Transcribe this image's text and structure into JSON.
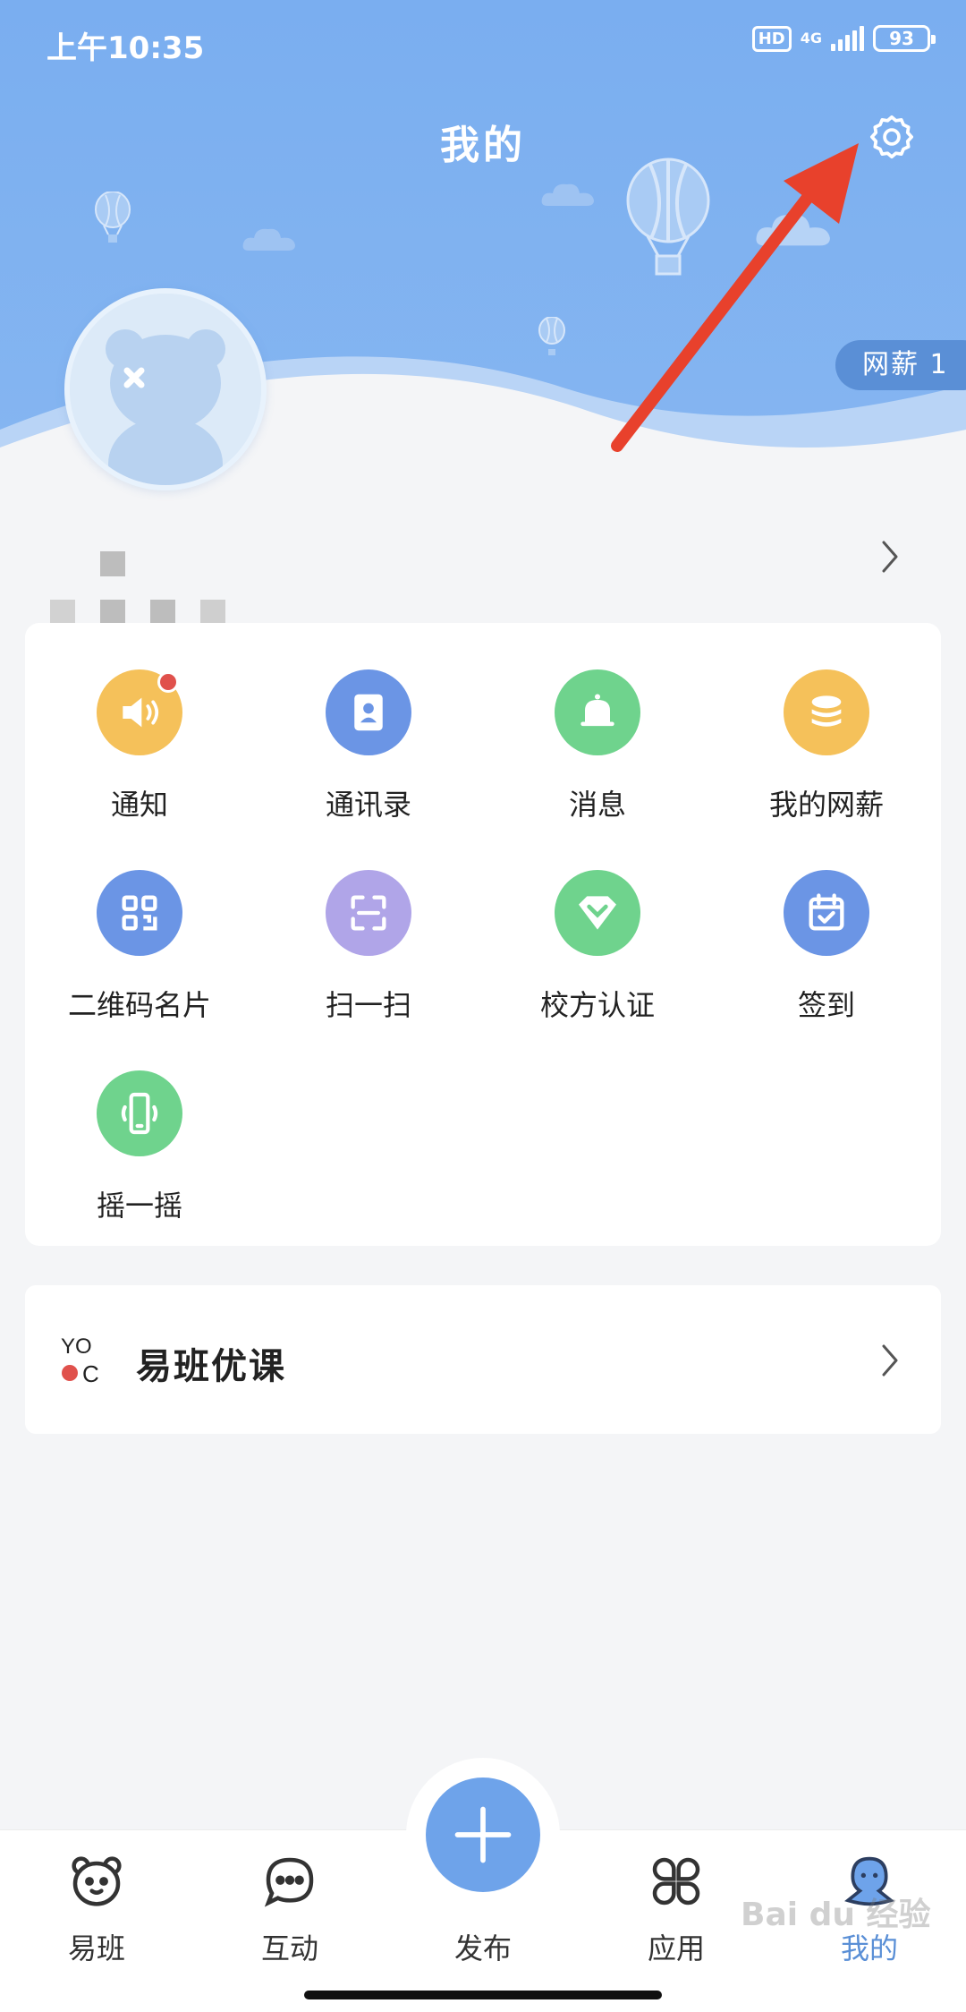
{
  "status_bar": {
    "time": "上午10:35",
    "hd": "HD",
    "network": "4G",
    "battery": "93"
  },
  "header": {
    "title": "我的",
    "salary_badge": "网薪 1"
  },
  "grid": {
    "items": [
      {
        "label": "通知",
        "icon": "speaker-icon",
        "color": "#f5c15a",
        "has_badge": true
      },
      {
        "label": "通讯录",
        "icon": "contacts-icon",
        "color": "#6b95e5"
      },
      {
        "label": "消息",
        "icon": "bell-icon",
        "color": "#6fd38d"
      },
      {
        "label": "我的网薪",
        "icon": "coins-icon",
        "color": "#f5c15a"
      },
      {
        "label": "二维码名片",
        "icon": "qr-code-icon",
        "color": "#6b95e5"
      },
      {
        "label": "扫一扫",
        "icon": "scan-icon",
        "color": "#b0a5e8"
      },
      {
        "label": "校方认证",
        "icon": "diamond-icon",
        "color": "#6fd38d"
      },
      {
        "label": "签到",
        "icon": "calendar-check-icon",
        "color": "#6b95e5"
      },
      {
        "label": "摇一摇",
        "icon": "phone-shake-icon",
        "color": "#6fd38d"
      }
    ]
  },
  "course": {
    "title": "易班优课",
    "logo_text": "YO OC"
  },
  "bottom_nav": {
    "items": [
      {
        "label": "易班",
        "icon": "bear-icon"
      },
      {
        "label": "互动",
        "icon": "chat-icon"
      },
      {
        "label": "发布",
        "icon": "plus-icon"
      },
      {
        "label": "应用",
        "icon": "apps-icon"
      },
      {
        "label": "我的",
        "icon": "profile-icon",
        "active": true
      }
    ]
  },
  "watermark": "Bai du 经验",
  "colors": {
    "header": "#7aaef0",
    "accent": "#5a8fd6",
    "fab": "#6ea3ea",
    "arrow": "#e8412c"
  }
}
